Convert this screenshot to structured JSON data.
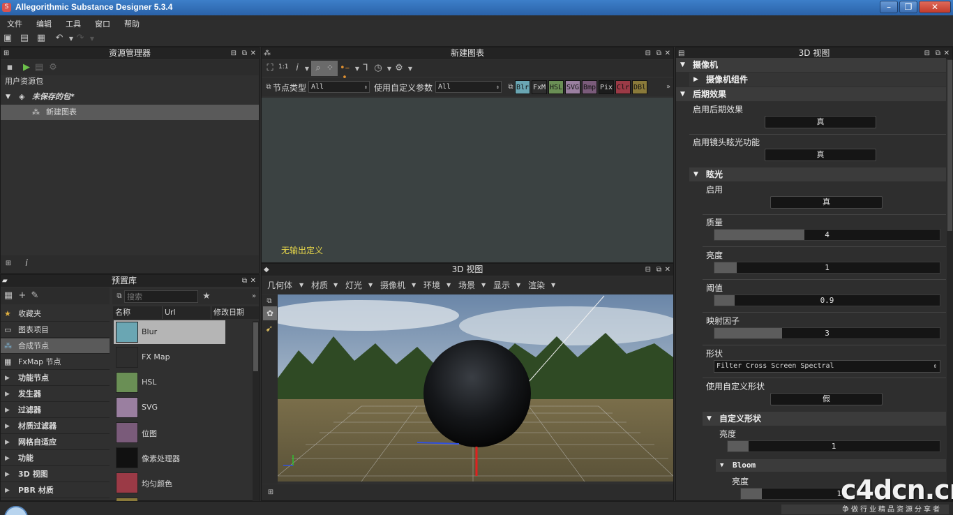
{
  "window": {
    "title": "Allegorithmic Substance Designer 5.3.4"
  },
  "menu": [
    "文件",
    "编辑",
    "工具",
    "窗口",
    "帮助"
  ],
  "explorer": {
    "title": "资源管理器",
    "root": "用户资源包",
    "package": "未保存的包*",
    "graph": "新建图表"
  },
  "graph": {
    "title": "新建图表",
    "node_type_label": "节点类型",
    "node_type_value": "All",
    "custom_params_label": "使用自定义参数",
    "custom_params_value": "All",
    "zoom_label": "1:1",
    "chips": [
      {
        "label": "Blr",
        "color": "#6aa6b3"
      },
      {
        "label": "FxM",
        "color": "#2e2e2e"
      },
      {
        "label": "HSL",
        "color": "#6a8f55"
      },
      {
        "label": "SVG",
        "color": "#9a7fa0"
      },
      {
        "label": "Bmp",
        "color": "#7a5b7a"
      },
      {
        "label": "Pix",
        "color": "#1c1c1c"
      },
      {
        "label": "Clr",
        "color": "#9b3a46"
      },
      {
        "label": "DBl",
        "color": "#8a7a3a"
      }
    ],
    "no_output": "无输出定义"
  },
  "library": {
    "title": "预置库",
    "search_placeholder": "搜索",
    "columns": [
      "名称",
      "Url",
      "修改日期"
    ],
    "categories_plain": [
      "收藏夹",
      "图表项目",
      "合成节点",
      "FxMap 节点"
    ],
    "categories_bold": [
      "功能节点",
      "发生器",
      "过滤器",
      "材质过滤器",
      "网格自适应",
      "功能",
      "3D 视图",
      "PBR 材质"
    ],
    "items": [
      {
        "name": "Blur",
        "color": "#6aa6b3"
      },
      {
        "name": "FX Map",
        "color": "#2e2e2e"
      },
      {
        "name": "HSL",
        "color": "#6a8f55"
      },
      {
        "name": "SVG",
        "color": "#9a7fa0"
      },
      {
        "name": "位图",
        "color": "#7a5b7a"
      },
      {
        "name": "像素处理器",
        "color": "#111111"
      },
      {
        "name": "均匀颜色",
        "color": "#9b3a46"
      }
    ]
  },
  "view3d": {
    "title": "3D 视图",
    "menu": [
      "几何体",
      "材质",
      "灯光",
      "摄像机",
      "环境",
      "场景",
      "显示",
      "渲染"
    ]
  },
  "properties": {
    "title": "3D 视图",
    "camera": "摄像机",
    "camera_components": "摄像机组件",
    "post_effects": "后期效果",
    "enable_post": "启用后期效果",
    "enable_post_value": "真",
    "enable_glare": "启用镜头眩光功能",
    "enable_glare_value": "真",
    "glare": "眩光",
    "enable": "启用",
    "enable_value": "真",
    "quality": "质量",
    "quality_value": "4",
    "quality_fill": 0.4,
    "brightness": "亮度",
    "brightness_value": "1",
    "brightness_fill": 0.1,
    "threshold": "阈值",
    "threshold_value": "0.9",
    "threshold_fill": 0.09,
    "reflect": "映射因子",
    "reflect_value": "3",
    "reflect_fill": 0.3,
    "shape": "形状",
    "shape_value": "Filter Cross Screen Spectral",
    "use_custom": "使用自定义形状",
    "use_custom_value": "假",
    "custom_shape": "自定义形状",
    "custom_brightness": "亮度",
    "custom_brightness_value": "1",
    "bloom": "Bloom",
    "bloom_brightness": "亮度",
    "bloom_brightness_value": "1"
  },
  "watermark": {
    "site": "c4dcn.cn",
    "slogan": "争做行业精品资源分享者"
  }
}
